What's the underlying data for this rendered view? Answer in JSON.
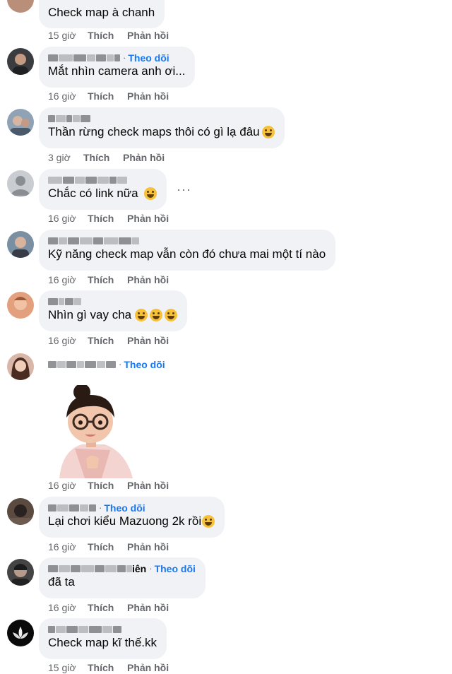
{
  "labels": {
    "like": "Thích",
    "reply": "Phản hồi",
    "follow": "Theo dõi",
    "more": "···"
  },
  "comments": [
    {
      "text": "Check map à chanh",
      "time": "15 giờ"
    },
    {
      "text": "Mắt nhìn camera anh ơi...",
      "time": "16 giờ",
      "follow": true
    },
    {
      "text": "Thần rừng check maps thôi có gì lạ đâu",
      "time": "3 giờ",
      "emoji": "rolling-laughing"
    },
    {
      "text": "Chắc có link nữa",
      "time": "16 giờ",
      "emoji": "grinning"
    },
    {
      "text": "Kỹ năng check map vẫn còn đó chưa mai một tí nào",
      "time": "16 giờ"
    },
    {
      "text": "Nhìn gì vay cha",
      "time": "16 giờ",
      "emoji": "tears-of-joy x3"
    },
    {
      "text": "",
      "time": "16 giờ",
      "follow": true,
      "sticker": "girl-with-glasses-sticker"
    },
    {
      "text": "Lại chơi kiểu Mazuong 2k rồi",
      "time": "16 giờ",
      "follow": true,
      "emoji": "grinning-squint"
    },
    {
      "text": "đã ta",
      "time": "16 giờ",
      "follow": true,
      "name_suffix": "iên"
    },
    {
      "text": "Check map kĩ thế.kk",
      "time": "15 giờ"
    }
  ]
}
